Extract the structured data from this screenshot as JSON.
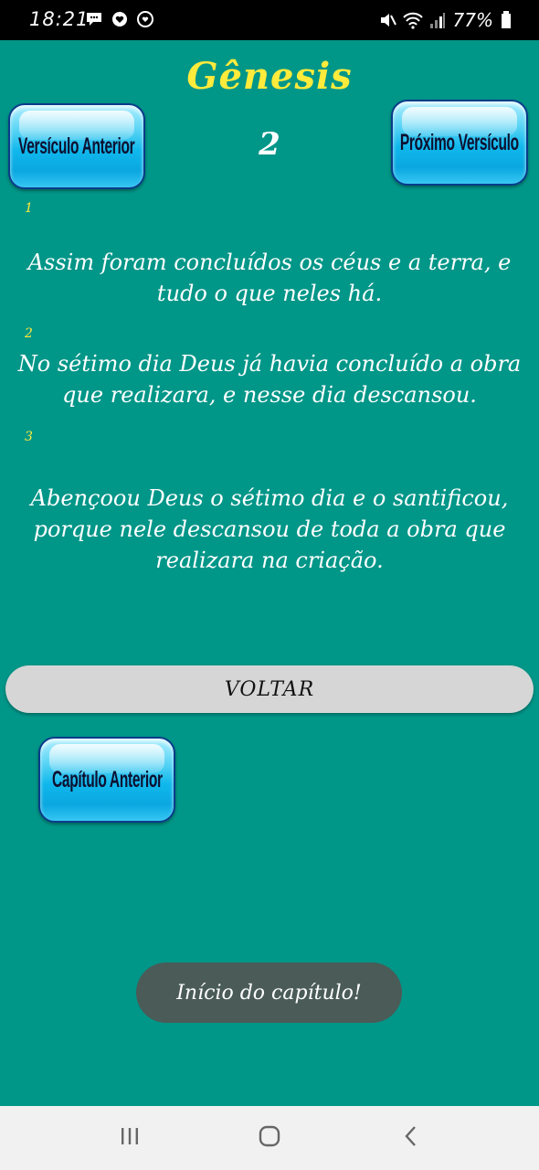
{
  "status_bar": {
    "time": "18:21",
    "battery": "77%",
    "left_icons": [
      "chat-bubble-icon",
      "heart-message-icon",
      "messenger-icon"
    ],
    "right_icons": [
      "mute-icon",
      "wifi-icon",
      "signal-icon",
      "battery-icon"
    ]
  },
  "header": {
    "book": "Gênesis",
    "chapter": "2",
    "prev_verse_label": "Versículo Anterior",
    "next_verse_label": "Próximo Versículo"
  },
  "verses": [
    {
      "number": "1",
      "text": "Assim foram concluídos os céus e a terra, e tudo o que neles há."
    },
    {
      "number": "2",
      "text": "No sétimo dia Deus já havia concluído a obra que realizara, e nesse dia descansou."
    },
    {
      "number": "3",
      "text": "Abençoou Deus o sétimo dia e o santificou, porque nele descansou de toda a obra que realizara na criação."
    }
  ],
  "actions": {
    "back_label": "VOLTAR",
    "prev_chapter_label": "Capítulo Anterior"
  },
  "toast": {
    "message": "Início do capítulo!"
  },
  "nav_bar": {
    "icons": [
      "recents-icon",
      "home-icon",
      "back-icon"
    ]
  },
  "colors": {
    "background": "#009688",
    "title": "#ffeb3b",
    "verse_number": "#ffeb3b",
    "verse_text": "#ffffff",
    "button_blue": "#10b8ec",
    "back_button": "#d6d6d6",
    "toast_bg": "#4a5b58"
  }
}
